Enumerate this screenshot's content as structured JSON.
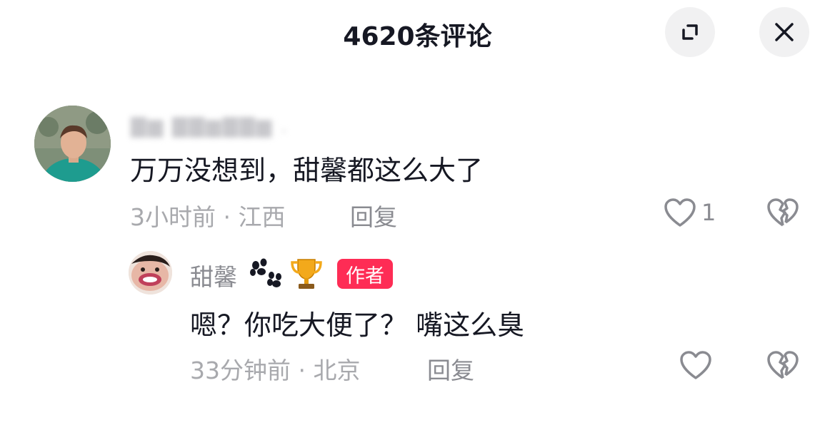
{
  "header": {
    "title": "4620条评论"
  },
  "comments": [
    {
      "author_blurred": "",
      "text": "万万没想到，甜馨都这么大了",
      "meta": "3小时前 · 江西",
      "reply_label": "回复",
      "like_count": "1",
      "replies": [
        {
          "author": "甜馨",
          "badge": "作者",
          "text": "嗯？你吃大便了？ 嘴这么臭",
          "meta": "33分钟前 · 北京",
          "reply_label": "回复"
        }
      ]
    }
  ],
  "colors": {
    "accent": "#fe2c55",
    "text": "#161823",
    "muted": "#a8a9ad"
  }
}
